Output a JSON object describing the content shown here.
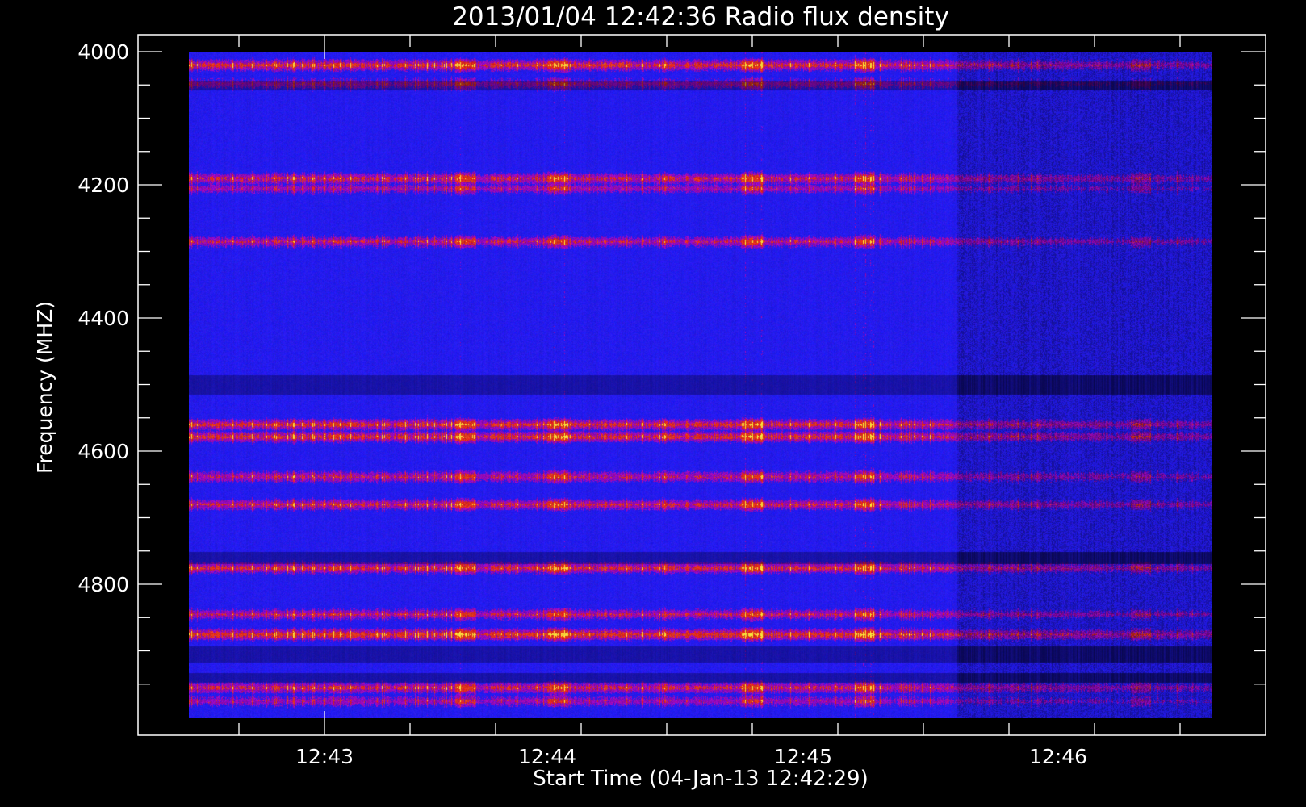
{
  "chart_data": {
    "type": "heatmap",
    "title": "2013/01/04 12:42:36 Radio flux density",
    "xlabel": "Start Time (04-Jan-13 12:42:29)",
    "ylabel": "Frequency (MHZ)",
    "x_ticks": [
      "12:43",
      "12:44",
      "12:45",
      "12:46"
    ],
    "y_ticks": [
      4000,
      4200,
      4400,
      4600,
      4800
    ],
    "ylim": [
      4000,
      5000
    ],
    "y_inverted": true,
    "data_range_x": [
      "12:42:36",
      "12:46:36"
    ],
    "colors": {
      "background": "#000000",
      "low": "#000000",
      "base": "#2a1cff",
      "mid": "#c8121a",
      "high": "#ffd24a",
      "axis": "#ffffff"
    },
    "bright_bands_mhz": [
      {
        "center": 4020,
        "strength": 0.85
      },
      {
        "center": 4048,
        "strength": 0.55
      },
      {
        "center": 4190,
        "strength": 0.75
      },
      {
        "center": 4205,
        "strength": 0.55
      },
      {
        "center": 4285,
        "strength": 0.65
      },
      {
        "center": 4560,
        "strength": 0.8
      },
      {
        "center": 4578,
        "strength": 0.85
      },
      {
        "center": 4638,
        "strength": 0.65
      },
      {
        "center": 4680,
        "strength": 0.7
      },
      {
        "center": 4775,
        "strength": 0.8
      },
      {
        "center": 4845,
        "strength": 0.65
      },
      {
        "center": 4875,
        "strength": 0.9
      },
      {
        "center": 4955,
        "strength": 0.75
      },
      {
        "center": 4975,
        "strength": 0.55
      }
    ]
  }
}
